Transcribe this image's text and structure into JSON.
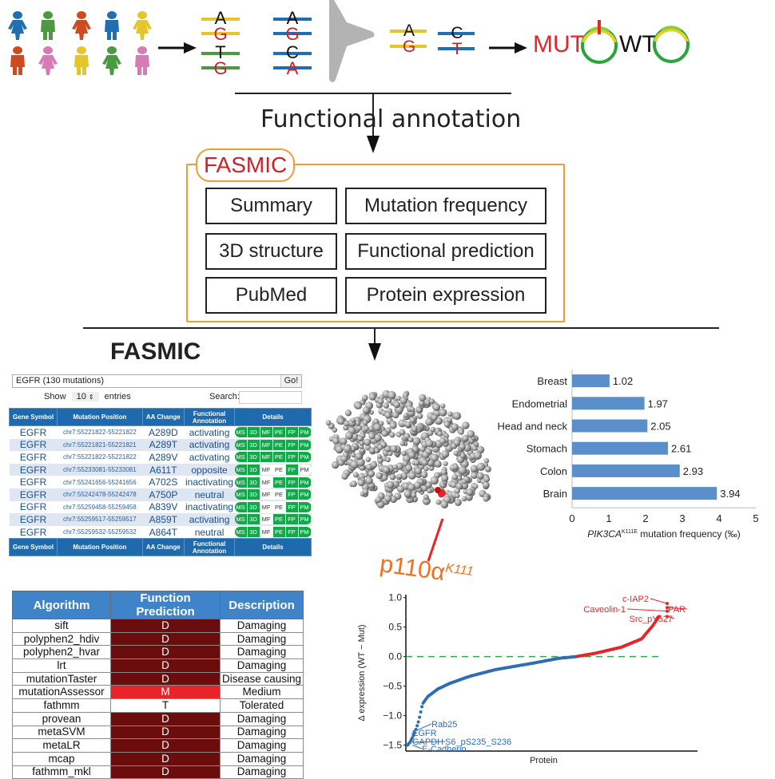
{
  "pipeline": {
    "people_colors": [
      "#1e6fb3",
      "#4a9a3f",
      "#cf4a1f",
      "#1e6fb3",
      "#e4c62a",
      "#cf4a1f",
      "#d77ab8",
      "#e4c62a",
      "#4a9a3f",
      "#d77ab8"
    ],
    "people_sexes": [
      "female",
      "male",
      "female",
      "male",
      "female",
      "male",
      "female",
      "male",
      "female",
      "male"
    ],
    "reads_group1": [
      {
        "ref": "A",
        "alt": "G",
        "color": "#e4c62a"
      },
      {
        "ref": "T",
        "alt": "G",
        "color": "#4a9a3f"
      }
    ],
    "reads_group2": [
      {
        "ref": "A",
        "alt": "G",
        "color": "#1e6fb3"
      },
      {
        "ref": "C",
        "alt": "A",
        "color": "#1e6fb3"
      }
    ],
    "reads_filtered": [
      {
        "ref": "A",
        "alt": "G",
        "color": "#e4c62a"
      },
      {
        "ref": "C",
        "alt": "T",
        "color": "#1e6fb3"
      }
    ],
    "mut_label": "MUT",
    "wt_label": "WT",
    "mut_color": "#e8242a"
  },
  "flow": {
    "functional_annotation_label": "Functional annotation"
  },
  "fasmic_box": {
    "tag": "FASMIC",
    "modules": [
      {
        "label": "Summary"
      },
      {
        "label": "Mutation frequency"
      },
      {
        "label": "3D structure"
      },
      {
        "label": "Functional prediction"
      },
      {
        "label": "PubMed"
      },
      {
        "label": "Protein expression"
      }
    ]
  },
  "fasmic_title": "FASMIC",
  "mutation_table": {
    "query": "EGFR (130 mutations)",
    "go_label": "Go!",
    "show_label": "Show",
    "entries_value": "10",
    "entries_label": "entries",
    "search_label": "Search:",
    "search_value": "",
    "columns": [
      "Gene Symbol",
      "Mutation Position",
      "AA Change",
      "Functional Annotation",
      "Details"
    ],
    "detail_codes": [
      "MS",
      "3D",
      "MF",
      "PE",
      "FP",
      "PM"
    ],
    "rows": [
      {
        "gene": "EGFR",
        "position": "chr7:55221822-55221822",
        "aa": "A289D",
        "annotation": "activating",
        "details": [
          1,
          1,
          1,
          1,
          1,
          1
        ]
      },
      {
        "gene": "EGFR",
        "position": "chr7:55221821-55221821",
        "aa": "A289T",
        "annotation": "activating",
        "details": [
          1,
          1,
          1,
          1,
          1,
          1
        ]
      },
      {
        "gene": "EGFR",
        "position": "chr7:55221822-55221822",
        "aa": "A289V",
        "annotation": "activating",
        "details": [
          1,
          1,
          1,
          1,
          1,
          1
        ]
      },
      {
        "gene": "EGFR",
        "position": "chr7:55233081-55233081",
        "aa": "A611T",
        "annotation": "opposite",
        "details": [
          1,
          1,
          0,
          0,
          1,
          0
        ]
      },
      {
        "gene": "EGFR",
        "position": "chr7:55241656-55241656",
        "aa": "A702S",
        "annotation": "inactivating",
        "details": [
          1,
          1,
          0,
          1,
          1,
          1
        ]
      },
      {
        "gene": "EGFR",
        "position": "chr7:55242478-55242478",
        "aa": "A750P",
        "annotation": "neutral",
        "details": [
          1,
          1,
          0,
          0,
          1,
          1
        ]
      },
      {
        "gene": "EGFR",
        "position": "chr7:55259458-55259458",
        "aa": "A839V",
        "annotation": "inactivating",
        "details": [
          1,
          1,
          0,
          0,
          1,
          1
        ]
      },
      {
        "gene": "EGFR",
        "position": "chr7:55259517-55259517",
        "aa": "A859T",
        "annotation": "activating",
        "details": [
          1,
          1,
          0,
          1,
          1,
          1
        ]
      },
      {
        "gene": "EGFR",
        "position": "chr7:55259532-55259532",
        "aa": "A864T",
        "annotation": "neutral",
        "details": [
          1,
          1,
          0,
          1,
          1,
          1
        ]
      }
    ]
  },
  "structure": {
    "label_main": "p110α",
    "label_sup": "K111",
    "highlight_color": "#e8242a",
    "label_color": "#f07020"
  },
  "prediction_table": {
    "columns": [
      "Algorithm",
      "Function Prediction",
      "Description"
    ],
    "rows": [
      {
        "algorithm": "sift",
        "prediction": "D",
        "description": "Damaging"
      },
      {
        "algorithm": "polyphen2_hdiv",
        "prediction": "D",
        "description": "Damaging"
      },
      {
        "algorithm": "polyphen2_hvar",
        "prediction": "D",
        "description": "Damaging"
      },
      {
        "algorithm": "lrt",
        "prediction": "D",
        "description": "Damaging"
      },
      {
        "algorithm": "mutationTaster",
        "prediction": "D",
        "description": "Disease causing"
      },
      {
        "algorithm": "mutationAssessor",
        "prediction": "M",
        "description": "Medium"
      },
      {
        "algorithm": "fathmm",
        "prediction": "T",
        "description": "Tolerated"
      },
      {
        "algorithm": "provean",
        "prediction": "D",
        "description": "Damaging"
      },
      {
        "algorithm": "metaSVM",
        "prediction": "D",
        "description": "Damaging"
      },
      {
        "algorithm": "metaLR",
        "prediction": "D",
        "description": "Damaging"
      },
      {
        "algorithm": "mcap",
        "prediction": "D",
        "description": "Damaging"
      },
      {
        "algorithm": "fathmm_mkl",
        "prediction": "D",
        "description": "Damaging"
      }
    ]
  },
  "chart_data": [
    {
      "type": "bar",
      "orientation": "horizontal",
      "categories": [
        "Breast",
        "Endometrial",
        "Head and neck",
        "Stomach",
        "Colon",
        "Brain"
      ],
      "values": [
        1.02,
        1.97,
        2.05,
        2.61,
        2.93,
        3.94
      ],
      "data_labels": [
        "1.02",
        "1.97",
        "2.05",
        "2.61",
        "2.93",
        "3.94"
      ],
      "xlabel_italic": "PIK3CA",
      "xlabel_sup": "K111E",
      "xlabel_rest": " mutation frequency (‰)",
      "xlim": [
        0,
        5
      ],
      "xticks": [
        "0",
        "1",
        "2",
        "3",
        "4",
        "5"
      ],
      "bar_color": "#5b8fc9",
      "grid": false,
      "legend": "none"
    },
    {
      "type": "scatter",
      "title": "",
      "xlabel": "Protein",
      "ylabel": "Δ expression (WT − Mut)",
      "ylim": [
        -1.6,
        1.05
      ],
      "yticks": [
        "1.0",
        "0.5",
        "0.0",
        "−0.5",
        "−1.0",
        "−1.5"
      ],
      "ytick_values": [
        1.0,
        0.5,
        0.0,
        -0.5,
        -1.0,
        -1.5
      ],
      "reference_line": {
        "y": 0.0,
        "style": "dashed",
        "color": "#22b04a"
      },
      "negative_color": "#2f6db4",
      "positive_color": "#e8242a",
      "n_proteins": 210,
      "curve_anchors": [
        {
          "rank": 0.0,
          "value": -1.5
        },
        {
          "rank": 0.01,
          "value": -1.45
        },
        {
          "rank": 0.02,
          "value": -1.37
        },
        {
          "rank": 0.03,
          "value": -1.28
        },
        {
          "rank": 0.045,
          "value": -1.08
        },
        {
          "rank": 0.06,
          "value": -0.8
        },
        {
          "rank": 0.08,
          "value": -0.68
        },
        {
          "rank": 0.12,
          "value": -0.55
        },
        {
          "rank": 0.17,
          "value": -0.45
        },
        {
          "rank": 0.25,
          "value": -0.33
        },
        {
          "rank": 0.35,
          "value": -0.22
        },
        {
          "rank": 0.5,
          "value": -0.11
        },
        {
          "rank": 0.6,
          "value": -0.03
        },
        {
          "rank": 0.67,
          "value": 0.0
        },
        {
          "rank": 0.75,
          "value": 0.06
        },
        {
          "rank": 0.85,
          "value": 0.16
        },
        {
          "rank": 0.93,
          "value": 0.3
        },
        {
          "rank": 0.97,
          "value": 0.5
        },
        {
          "rank": 0.99,
          "value": 0.62
        },
        {
          "rank": 1.0,
          "value": 0.68
        }
      ],
      "annotations": [
        {
          "label": "Rab25",
          "value": -1.28,
          "side": "negative"
        },
        {
          "label": "EGFR",
          "value": -1.37,
          "side": "negative"
        },
        {
          "label": "GAPDH",
          "value": -1.45,
          "side": "negative"
        },
        {
          "label": "S6_pS235_S236",
          "value": -1.45,
          "side": "negative"
        },
        {
          "label": "E-Cadherin",
          "value": -1.5,
          "side": "negative"
        },
        {
          "label": "c-IAP2",
          "value": 0.9,
          "side": "positive"
        },
        {
          "label": "PAR",
          "value": 0.83,
          "side": "positive"
        },
        {
          "label": "Caveolin-1",
          "value": 0.77,
          "side": "positive"
        },
        {
          "label": "Src_pY527",
          "value": 0.68,
          "side": "positive"
        }
      ]
    }
  ]
}
